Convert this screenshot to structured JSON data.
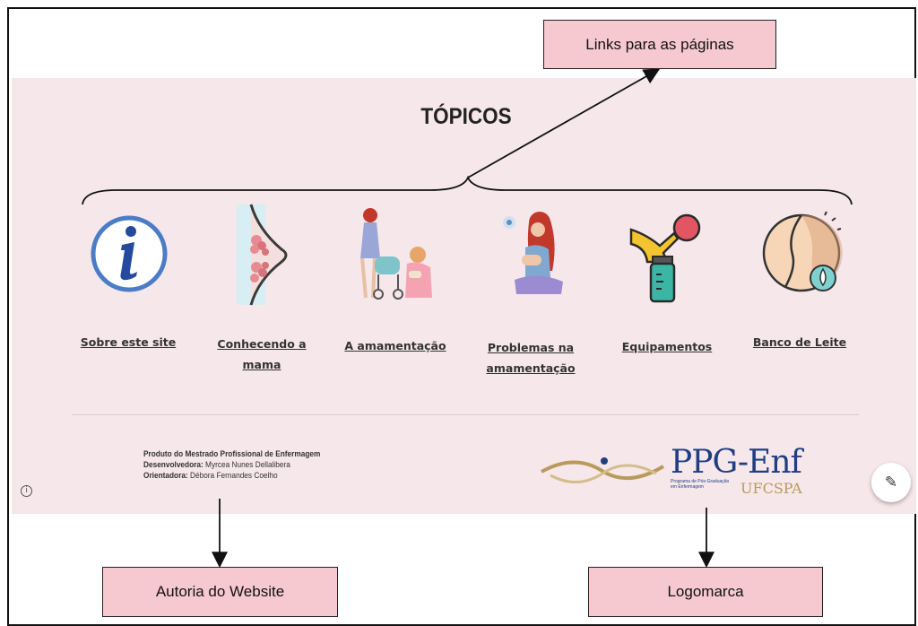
{
  "callouts": {
    "links": "Links para as páginas",
    "author": "Autoria do Website",
    "logo": "Logomarca"
  },
  "site": {
    "title": "TÓPICOS",
    "topics": [
      {
        "line1": "Sobre este site",
        "line2": "",
        "icon": "info-icon"
      },
      {
        "line1": "Conhecendo a",
        "line2": "mama",
        "icon": "breast-anatomy-icon"
      },
      {
        "line1": "A amamentação",
        "line2": "",
        "icon": "mothers-with-stroller-icon"
      },
      {
        "line1": "Problemas na",
        "line2": "amamentação",
        "icon": "mother-breastfeeding-icon"
      },
      {
        "line1": "Equipamentos",
        "line2": "",
        "icon": "breast-pump-icon"
      },
      {
        "line1": "Banco de Leite",
        "line2": "",
        "icon": "milk-bank-icon"
      }
    ],
    "credits": {
      "product": "Produto do Mestrado Profissional de Enfermagem",
      "developer_label": "Desenvolvedora:",
      "developer": "Myrcea Nunes Dellalibera",
      "advisor_label": "Orientadora:",
      "advisor": "Débora Fernandes Coelho"
    },
    "logo": {
      "main": "PPG-Enf",
      "sub": "Programa de Pós-Graduação em Enfermagem",
      "institution": "UFCSPA"
    },
    "info_glyph": "i",
    "edit_glyph": "✎"
  },
  "colors": {
    "site_background": "#f6e7ea",
    "callout_fill": "#f5c9cf",
    "logo_blue": "#1f3f82",
    "logo_gold": "#b99a5a"
  }
}
